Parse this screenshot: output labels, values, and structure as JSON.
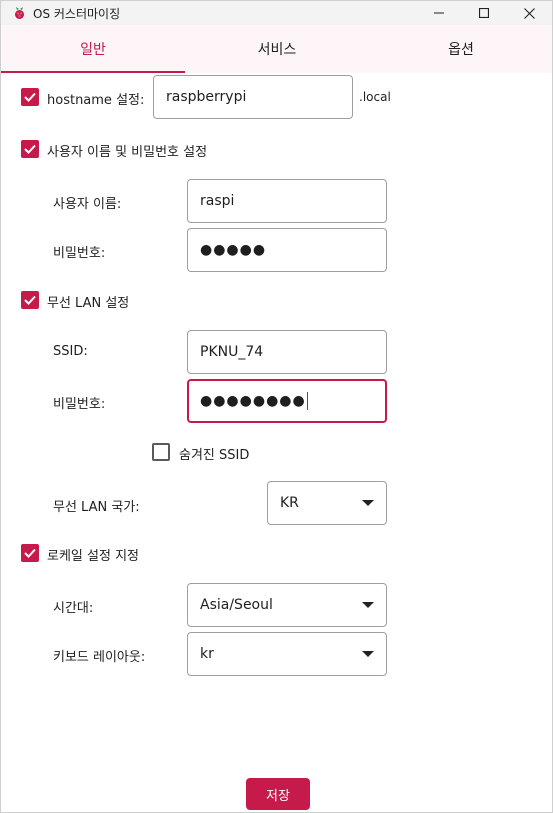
{
  "window": {
    "title": "OS 커스터마이징"
  },
  "tabs": [
    {
      "label": "일반"
    },
    {
      "label": "서비스"
    },
    {
      "label": "옵션"
    }
  ],
  "hostname": {
    "label": "hostname 설정:",
    "value": "raspberrypi",
    "suffix": ".local"
  },
  "user": {
    "section_label": "사용자 이름 및 비밀번호 설정",
    "username_label": "사용자 이름:",
    "username_value": "raspi",
    "password_label": "비밀번호:",
    "password_value": "●●●●●"
  },
  "wifi": {
    "section_label": "무선 LAN 설정",
    "ssid_label": "SSID:",
    "ssid_value": "PKNU_74",
    "password_label": "비밀번호:",
    "password_value": "●●●●●●●●",
    "hidden_label": "숨겨진 SSID",
    "country_label": "무선 LAN 국가:",
    "country_value": "KR"
  },
  "locale": {
    "section_label": "로케일 설정 지정",
    "timezone_label": "시간대:",
    "timezone_value": "Asia/Seoul",
    "keyboard_label": "키보드 레이아웃:",
    "keyboard_value": "kr"
  },
  "actions": {
    "save_label": "저장"
  },
  "colors": {
    "accent": "#c51a4a"
  }
}
